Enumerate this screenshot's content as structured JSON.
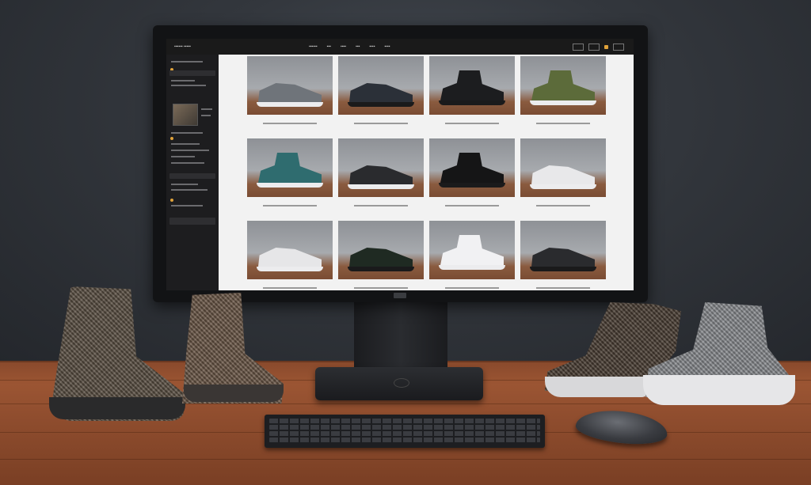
{
  "screen": {
    "topbar": {
      "brand": "▪▪▪▪▪▪ ▪▪▪▪▪",
      "nav": [
        "▪▪▪▪▪▪",
        "▪▪▪",
        "▪▪▪▪",
        "▪▪▪",
        "▪▪▪▪",
        "▪▪▪▪"
      ],
      "icons": [
        "search-icon",
        "account-icon",
        "cart-icon",
        "menu-icon"
      ]
    },
    "sidebar": {
      "icons": [
        "brand-logo-icon",
        "category-icon",
        "filter-icon"
      ]
    },
    "products": [
      {
        "shoe": "grey-runner",
        "color": "#6f747a"
      },
      {
        "shoe": "black-runner",
        "color": "#2b3038"
      },
      {
        "shoe": "black-high-top",
        "color": "#1c1d1f"
      },
      {
        "shoe": "olive-high-top",
        "color": "#5c6b3a"
      },
      {
        "shoe": "teal-red-basketball",
        "color": "#2f6c6f"
      },
      {
        "shoe": "black-low-sneaker",
        "color": "#2a2b2e"
      },
      {
        "shoe": "black-boot",
        "color": "#151516"
      },
      {
        "shoe": "white-sneaker",
        "color": "#e8e8ea"
      },
      {
        "shoe": "white-trainer",
        "color": "#e6e6e8"
      },
      {
        "shoe": "black-green-red-runner",
        "color": "#1f2a22"
      },
      {
        "shoe": "white-high-top",
        "color": "#f1f1f3"
      },
      {
        "shoe": "black-slip-on",
        "color": "#2a2b2e"
      }
    ]
  },
  "scene": {
    "desk_shoes": [
      "knit-boot-left",
      "knit-boot-mid",
      "knit-sneaker-right",
      "grey-knit-sneaker"
    ],
    "colors": {
      "wall": "#33373d",
      "desk": "#8f4d2e",
      "monitor": "#121315"
    }
  }
}
